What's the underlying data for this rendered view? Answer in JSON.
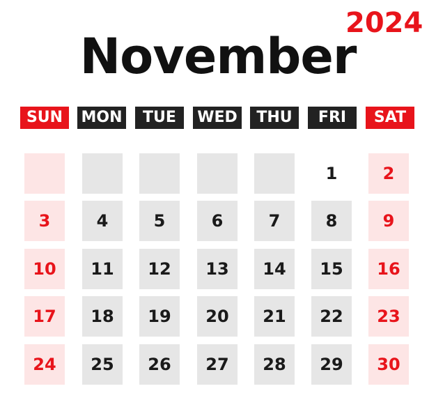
{
  "header": {
    "year": "2024",
    "month": "November"
  },
  "weekdays": [
    "SUN",
    "MON",
    "TUE",
    "WED",
    "THU",
    "FRI",
    "SAT"
  ],
  "weeks": [
    [
      "",
      "",
      "",
      "",
      "",
      "1",
      "2"
    ],
    [
      "3",
      "4",
      "5",
      "6",
      "7",
      "8",
      "9"
    ],
    [
      "10",
      "11",
      "12",
      "13",
      "14",
      "15",
      "16"
    ],
    [
      "17",
      "18",
      "19",
      "20",
      "21",
      "22",
      "23"
    ],
    [
      "24",
      "25",
      "26",
      "27",
      "28",
      "29",
      "30"
    ]
  ],
  "colors": {
    "accent": "#e8141b",
    "header_dark": "#222222",
    "cell_gray": "#e6e6e6",
    "cell_weekend": "#fde5e5",
    "text_dark": "#111111"
  }
}
